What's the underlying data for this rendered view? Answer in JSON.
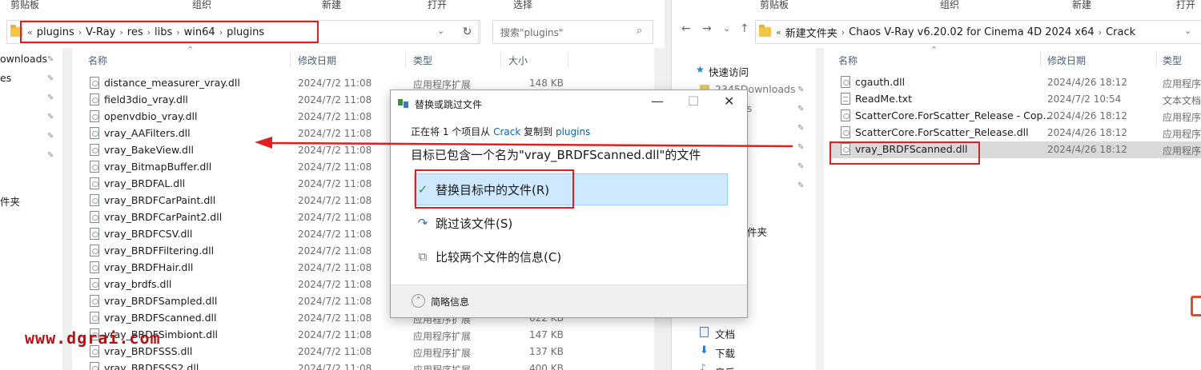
{
  "left_window": {
    "ribbon_groups": [
      "剪贴板",
      "组织",
      "新建",
      "打开",
      "选择"
    ],
    "address_segments": [
      "plugins",
      "V-Ray",
      "res",
      "libs",
      "win64",
      "plugins"
    ],
    "search_placeholder": "搜索\"plugins\"",
    "columns": [
      "名称",
      "修改日期",
      "类型",
      "大小"
    ],
    "sidebar": [
      {
        "label": "ownloads",
        "pinned": true
      },
      {
        "label": "es",
        "pinned": true
      },
      {
        "label": "",
        "pinned": true
      },
      {
        "label": "",
        "pinned": true
      },
      {
        "label": "",
        "pinned": true
      },
      {
        "label": "",
        "pinned": true
      },
      {
        "label": "件夹",
        "pinned": false
      }
    ],
    "files": [
      {
        "name": "distance_measurer_vray.dll",
        "date": "2024/7/2 11:08",
        "type": "应用程序扩展",
        "size": "148 KB"
      },
      {
        "name": "field3dio_vray.dll",
        "date": "2024/7/2 11:08",
        "type": "",
        "size": ""
      },
      {
        "name": "openvdbio_vray.dll",
        "date": "2024/7/2 11:08",
        "type": "",
        "size": ""
      },
      {
        "name": "vray_AAFilters.dll",
        "date": "2024/7/2 11:08",
        "type": "",
        "size": ""
      },
      {
        "name": "vray_BakeView.dll",
        "date": "2024/7/2 11:08",
        "type": "",
        "size": ""
      },
      {
        "name": "vray_BitmapBuffer.dll",
        "date": "2024/7/2 11:08",
        "type": "",
        "size": ""
      },
      {
        "name": "vray_BRDFAL.dll",
        "date": "2024/7/2 11:08",
        "type": "",
        "size": ""
      },
      {
        "name": "vray_BRDFCarPaint.dll",
        "date": "2024/7/2 11:08",
        "type": "",
        "size": ""
      },
      {
        "name": "vray_BRDFCarPaint2.dll",
        "date": "2024/7/2 11:08",
        "type": "",
        "size": ""
      },
      {
        "name": "vray_BRDFCSV.dll",
        "date": "2024/7/2 11:08",
        "type": "",
        "size": ""
      },
      {
        "name": "vray_BRDFFiltering.dll",
        "date": "2024/7/2 11:08",
        "type": "",
        "size": ""
      },
      {
        "name": "vray_BRDFHair.dll",
        "date": "2024/7/2 11:08",
        "type": "",
        "size": ""
      },
      {
        "name": "vray_brdfs.dll",
        "date": "2024/7/2 11:08",
        "type": "",
        "size": ""
      },
      {
        "name": "vray_BRDFSampled.dll",
        "date": "2024/7/2 11:08",
        "type": "",
        "size": ""
      },
      {
        "name": "vray_BRDFScanned.dll",
        "date": "2024/7/2 11:08",
        "type": "应用程序扩展",
        "size": "622 KB"
      },
      {
        "name": "vray_BRDFSimbiont.dll",
        "date": "2024/7/2 11:08",
        "type": "应用程序扩展",
        "size": "147 KB"
      },
      {
        "name": "vray_BRDFSSS.dll",
        "date": "2024/7/2 11:08",
        "type": "应用程序扩展",
        "size": "137 KB"
      },
      {
        "name": "vray_BRDFSSS2.dll",
        "date": "2024/7/2 11:08",
        "type": "应用程序扩展",
        "size": "400 KB"
      }
    ]
  },
  "right_window": {
    "ribbon_groups": [
      "剪贴板",
      "组织",
      "新建",
      "打开"
    ],
    "address_segments": [
      "新建文件夹",
      "Chaos V-Ray v6.20.02 for Cinema 4D 2024 x64",
      "Crack"
    ],
    "columns": [
      "名称",
      "修改日期",
      "类型"
    ],
    "sidebar": [
      {
        "label": "快速访问",
        "icon": "star-icon"
      },
      {
        "label": "2345Downloads",
        "icon": "folder-icon"
      },
      {
        "label": "es",
        "icon": ""
      },
      {
        "label": "件夹",
        "icon": ""
      },
      {
        "label": "文档",
        "icon": "document-icon"
      },
      {
        "label": "下载",
        "icon": "download-icon"
      },
      {
        "label": "音乐",
        "icon": "music-icon"
      }
    ],
    "files": [
      {
        "name": "cgauth.dll",
        "date": "2024/4/26 18:12",
        "type": "应用程序扩",
        "icon": "dll"
      },
      {
        "name": "ReadMe.txt",
        "date": "2024/7/2 10:54",
        "type": "文本文档",
        "icon": "txt"
      },
      {
        "name": "ScatterCore.ForScatter_Release - Cop...",
        "date": "2024/4/26 18:12",
        "type": "应用程序扩",
        "icon": "dll"
      },
      {
        "name": "ScatterCore.ForScatter_Release.dll",
        "date": "2024/4/26 18:12",
        "type": "应用程序扩",
        "icon": "dll"
      },
      {
        "name": "vray_BRDFScanned.dll",
        "date": "2024/4/26 18:12",
        "type": "应用程序扩",
        "icon": "dll"
      }
    ]
  },
  "dialog": {
    "title": "替换或跳过文件",
    "progress_prefix": "正在将 1 个项目从",
    "source": "Crack",
    "progress_middle": "复制到",
    "destination": "plugins",
    "heading": "目标已包含一个名为\"vray_BRDFScanned.dll\"的文件",
    "options": {
      "replace": "替换目标中的文件(R)",
      "skip": "跳过该文件(S)",
      "compare": "比较两个文件的信息(C)"
    },
    "footer_label": "简略信息",
    "minimize": "—",
    "maximize": "☐",
    "close": "✕"
  },
  "watermark": "www.dgrai.com",
  "colors": {
    "annotation_red": "#e02020",
    "selection_blue": "#cde8ff",
    "link_blue": "#0a64b4",
    "watermark": "#b01515"
  }
}
